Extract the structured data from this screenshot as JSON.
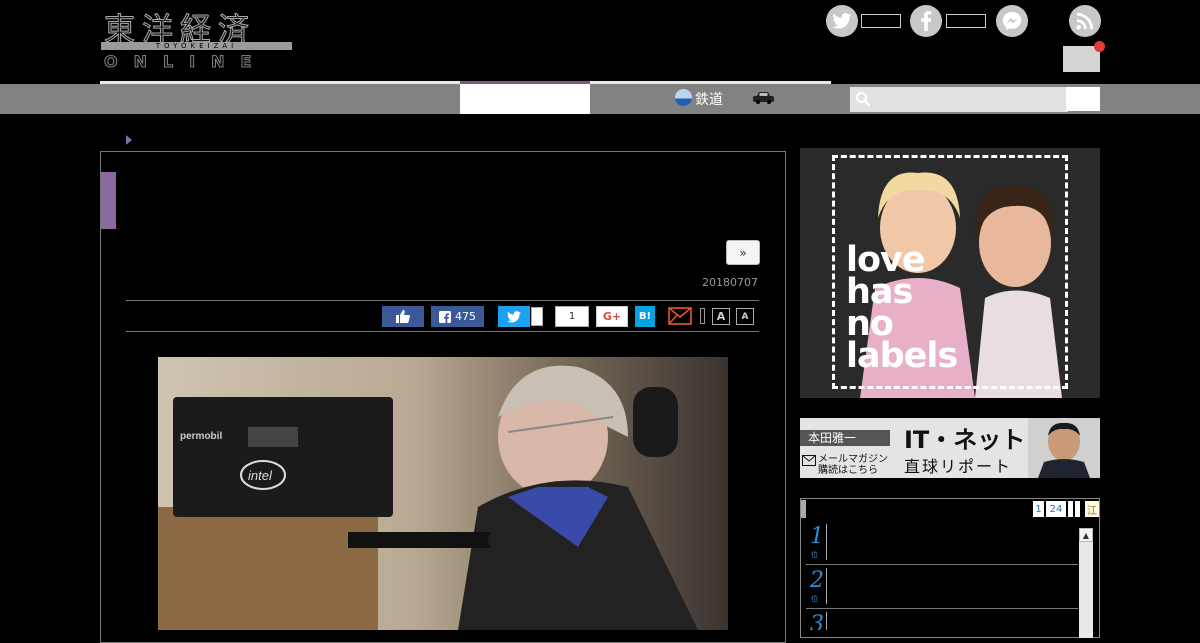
{
  "header": {
    "logo_kanji": "東洋経済",
    "logo_roman": "TOYOKEIZAI",
    "logo_online": "ONLINE",
    "social": [
      {
        "name": "twitter",
        "glyph": "t"
      },
      {
        "name": "facebook",
        "glyph": "f"
      },
      {
        "name": "messenger",
        "glyph": "m"
      },
      {
        "name": "rss",
        "glyph": "r"
      }
    ]
  },
  "nav": {
    "rail_label": "鉄道",
    "car_icon": "car-icon",
    "search_placeholder": ""
  },
  "article": {
    "next_label": "»",
    "date": "20180707",
    "share": {
      "fb_count": "475",
      "pocket_count": "1",
      "gplus_label": "G+",
      "hatena_label": "B!",
      "font_large": "A",
      "font_small": "A"
    },
    "photo_brand": "permobil",
    "photo_logo": "intel"
  },
  "sidebar": {
    "ad_text": [
      "love",
      "has",
      "no",
      "labels"
    ],
    "banner": {
      "author": "本田雅一",
      "title": "IT・ネット",
      "subtitle": "直球リポート",
      "mail_line1": "メールマガジン",
      "mail_line2": "購読はこちら"
    },
    "ranking": {
      "tabs": [
        "1",
        "24",
        "",
        "",
        "江"
      ],
      "rows": [
        {
          "rank": "1",
          "suffix": "位"
        },
        {
          "rank": "2",
          "suffix": "位"
        },
        {
          "rank": "3",
          "suffix": "位"
        }
      ]
    }
  },
  "colors": {
    "accent_purple": "#8a6aa0",
    "facebook": "#3b5998",
    "twitter": "#1da1f2",
    "hatena": "#00a4de",
    "rank_blue": "#2a8fd6",
    "nav_gray": "#828282"
  }
}
